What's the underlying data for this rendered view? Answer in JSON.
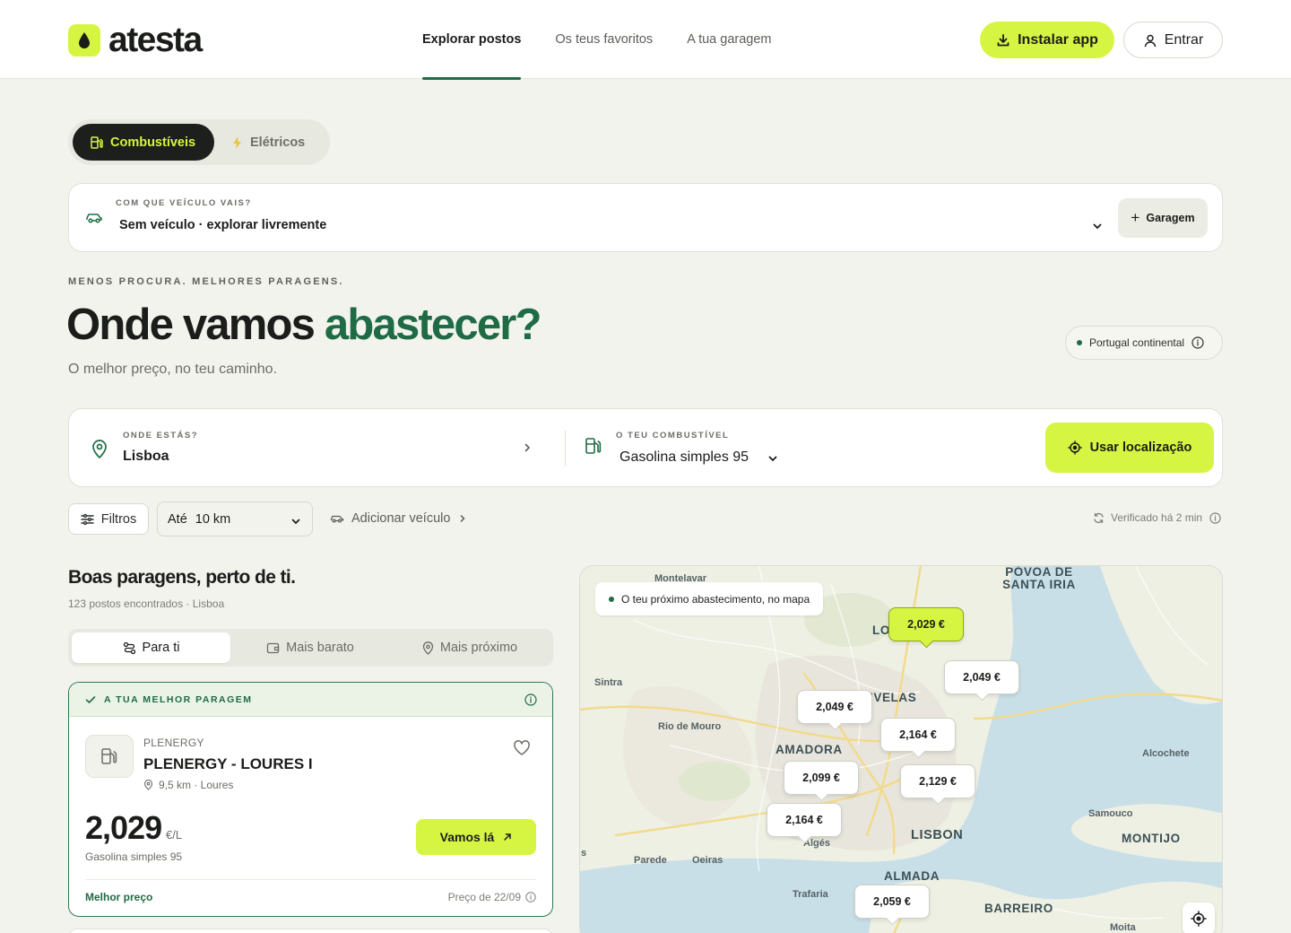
{
  "header": {
    "logo_text": "atesta",
    "nav": [
      {
        "label": "Explorar postos",
        "active": true
      },
      {
        "label": "Os teus favoritos",
        "active": false
      },
      {
        "label": "A tua garagem",
        "active": false
      }
    ],
    "install_label": "Instalar app",
    "login_label": "Entrar"
  },
  "mode": {
    "fuel_label": "Combustíveis",
    "electric_label": "Elétricos"
  },
  "vehicle": {
    "question": "Com que veículo vais?",
    "value": "Sem veículo · explorar livremente",
    "garage_label": "Garagem"
  },
  "hero": {
    "eyebrow": "Menos procura. Melhores paragens.",
    "title_main": "Onde vamos ",
    "title_accent": "abastecer?",
    "subtitle": "O melhor preço, no teu caminho.",
    "region": "Portugal continental"
  },
  "search": {
    "location_label": "Onde estás?",
    "location_value": "Lisboa",
    "fuel_label": "O teu combustível",
    "fuel_value": "Gasolina simples 95",
    "use_location_label": "Usar localização"
  },
  "filters": {
    "filters_label": "Filtros",
    "radius_prefix": "Até",
    "radius_value": "10 km",
    "add_vehicle_label": "Adicionar veículo",
    "verified_label": "Verificado há 2 min"
  },
  "results": {
    "title": "Boas paragens, perto de ti.",
    "meta": "123 postos encontrados · Lisboa",
    "sort_tabs": [
      "Para ti",
      "Mais barato",
      "Mais próximo"
    ]
  },
  "best": {
    "badge": "A tua melhor paragem",
    "brand": "PLENERGY",
    "name": "PLENERGY - LOURES I",
    "location": "9,5 km · Loures",
    "price": "2,029",
    "price_unit": "€/L",
    "fuel": "Gasolina simples 95",
    "go_label": "Vamos lá",
    "footer_left": "Melhor preço",
    "footer_right": "Preço de 22/09"
  },
  "map": {
    "caption": "O teu próximo abastecimento, no mapa",
    "labels": {
      "montelavar": "Montelavar",
      "povoa": "PÓVOA DE SANTA IRIA",
      "lo": "LO",
      "sintra": "Sintra",
      "ivelas": "IVELAS",
      "riomouro": "Rio de Mouro",
      "amadora": "AMADORA",
      "alcochete": "Alcochete",
      "samouco": "Samouco",
      "montijo": "MONTIJO",
      "lisbon": "LISBON",
      "alges": "Algés",
      "s": "s",
      "parede": "Parede",
      "oeiras": "Oeiras",
      "almada": "ALMADA",
      "trafaria": "Trafaria",
      "barreiro": "BARREIRO",
      "moita": "Moita"
    },
    "markers": [
      "2,029 €",
      "2,049 €",
      "2,049 €",
      "2,164 €",
      "2,099 €",
      "2,129 €",
      "2,164 €",
      "2,059 €"
    ]
  },
  "colors": {
    "accent": "#d6f542",
    "brand_green": "#1f6b45",
    "dark": "#1c1f1c"
  }
}
